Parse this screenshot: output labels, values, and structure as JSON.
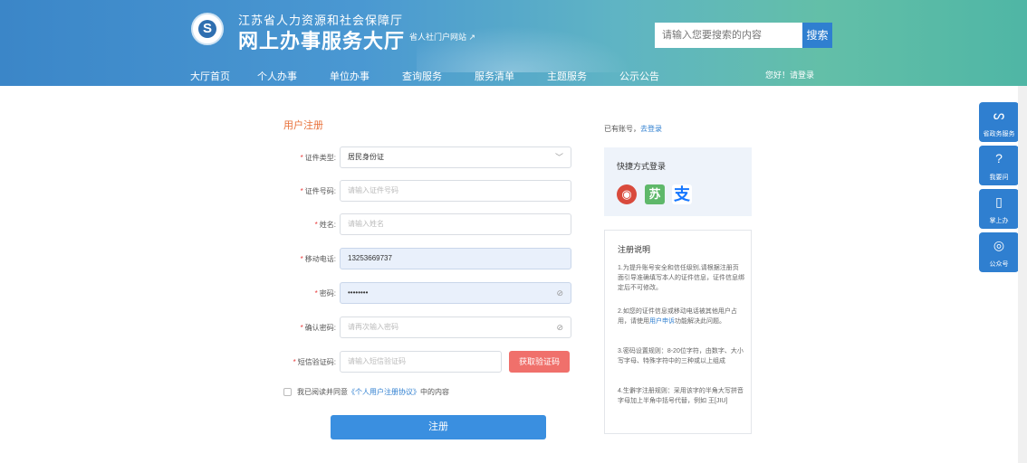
{
  "header": {
    "org_name": "江苏省人力资源和社会保障厅",
    "site_name": "网上办事服务大厅",
    "portal_link": "省人社门户网站",
    "search_placeholder": "请输入您要搜索的内容",
    "search_button": "搜索",
    "greeting": "您好！请登录",
    "nav": [
      "大厅首页",
      "个人办事",
      "单位办事",
      "查询服务",
      "服务清单",
      "主题服务",
      "公示公告"
    ]
  },
  "form": {
    "title": "用户注册",
    "fields": [
      {
        "label": "证件类型:",
        "value": "居民身份证",
        "placeholder": "",
        "suffix": "﹀"
      },
      {
        "label": "证件号码:",
        "value": "",
        "placeholder": "请输入证件号码",
        "suffix": ""
      },
      {
        "label": "姓名:",
        "value": "",
        "placeholder": "请输入姓名",
        "suffix": ""
      },
      {
        "label": "移动电话:",
        "value": "13253669737",
        "placeholder": "",
        "suffix": ""
      },
      {
        "label": "密码:",
        "value": "••••••••",
        "placeholder": "",
        "suffix": "⊘"
      },
      {
        "label": "确认密码:",
        "value": "",
        "placeholder": "请再次输入密码",
        "suffix": "⊘"
      },
      {
        "label": "短信验证码:",
        "value": "",
        "placeholder": "请输入短信验证码",
        "suffix": ""
      }
    ],
    "sms_button": "获取验证码",
    "agree_prefix": "我已阅读并同意",
    "agree_link": "《个人用户注册协议》",
    "agree_suffix": "中的内容",
    "submit": "注册"
  },
  "right": {
    "has_account": "已有账号，",
    "login_link": "去登录",
    "quick_title": "快捷方式登录",
    "notes_title": "注册说明",
    "note1": "1.为提升账号安全和信任级别,请根据注册页面引导准确填写本人的证件信息，证件信息绑定后不可修改。",
    "note2_a": "2.如您的证件信息或移动电话被其他用户占用，请使用",
    "note2_link": "用户申诉",
    "note2_b": "功能解决此问题。",
    "note3": "3.密码设置规则：8-20位字符，由数字、大小写字母、特殊字符中的三种或以上组成",
    "note4": "4.生僻字注册规则：采用该字的半角大写拼音字母加上半角中括号代替，例如 王[JIU]"
  },
  "sidebar": [
    {
      "label": "省政务服务",
      "icon": "ᔕ"
    },
    {
      "label": "我要问",
      "icon": "?"
    },
    {
      "label": "掌上办",
      "icon": "▯"
    },
    {
      "label": "公众号",
      "icon": "◎"
    }
  ]
}
